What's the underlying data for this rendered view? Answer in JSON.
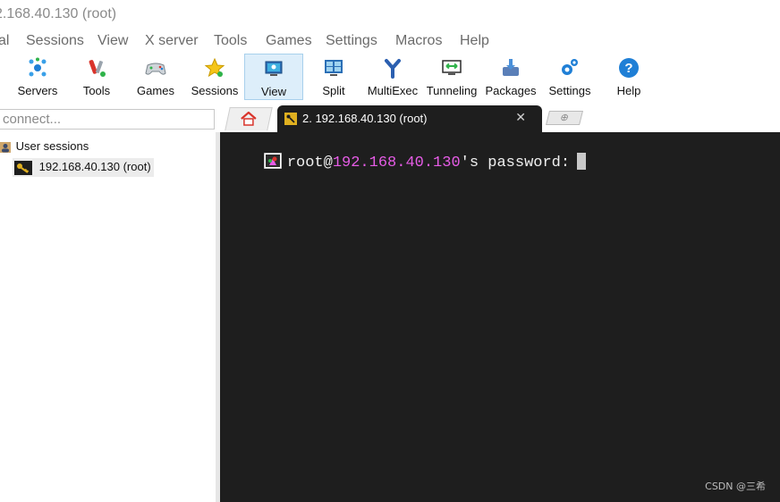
{
  "window": {
    "title": "2.168.40.130 (root)"
  },
  "menu": [
    "al",
    "Sessions",
    "View",
    "X server",
    "Tools",
    "Games",
    "Settings",
    "Macros",
    "Help"
  ],
  "toolbar": {
    "buttons": [
      {
        "label": "Servers",
        "icon": "servers-icon"
      },
      {
        "label": "Tools",
        "icon": "tools-icon"
      },
      {
        "label": "Games",
        "icon": "games-icon"
      },
      {
        "label": "Sessions",
        "icon": "sessions-star-icon"
      },
      {
        "label": "View",
        "icon": "view-icon",
        "active": true
      },
      {
        "label": "Split",
        "icon": "split-icon"
      },
      {
        "label": "MultiExec",
        "icon": "multiexec-icon"
      },
      {
        "label": "Tunneling",
        "icon": "tunneling-icon"
      },
      {
        "label": "Packages",
        "icon": "packages-icon"
      },
      {
        "label": "Settings",
        "icon": "settings-gear-icon"
      },
      {
        "label": "Help",
        "icon": "help-icon"
      }
    ]
  },
  "quick_connect": {
    "placeholder": "connect..."
  },
  "sidebar": {
    "root_label": "User sessions",
    "sessions": [
      {
        "label": "192.168.40.130 (root)"
      }
    ]
  },
  "tabs": {
    "active": {
      "label": "2. 192.168.40.130 (root)",
      "close": "✕"
    },
    "new_tab_symbol": "⊕"
  },
  "terminal": {
    "user": "root@",
    "host": "192.168.40.130",
    "prompt_suffix": "'s password:",
    "host_color": "#e65ce6"
  },
  "watermark": "CSDN @三希"
}
